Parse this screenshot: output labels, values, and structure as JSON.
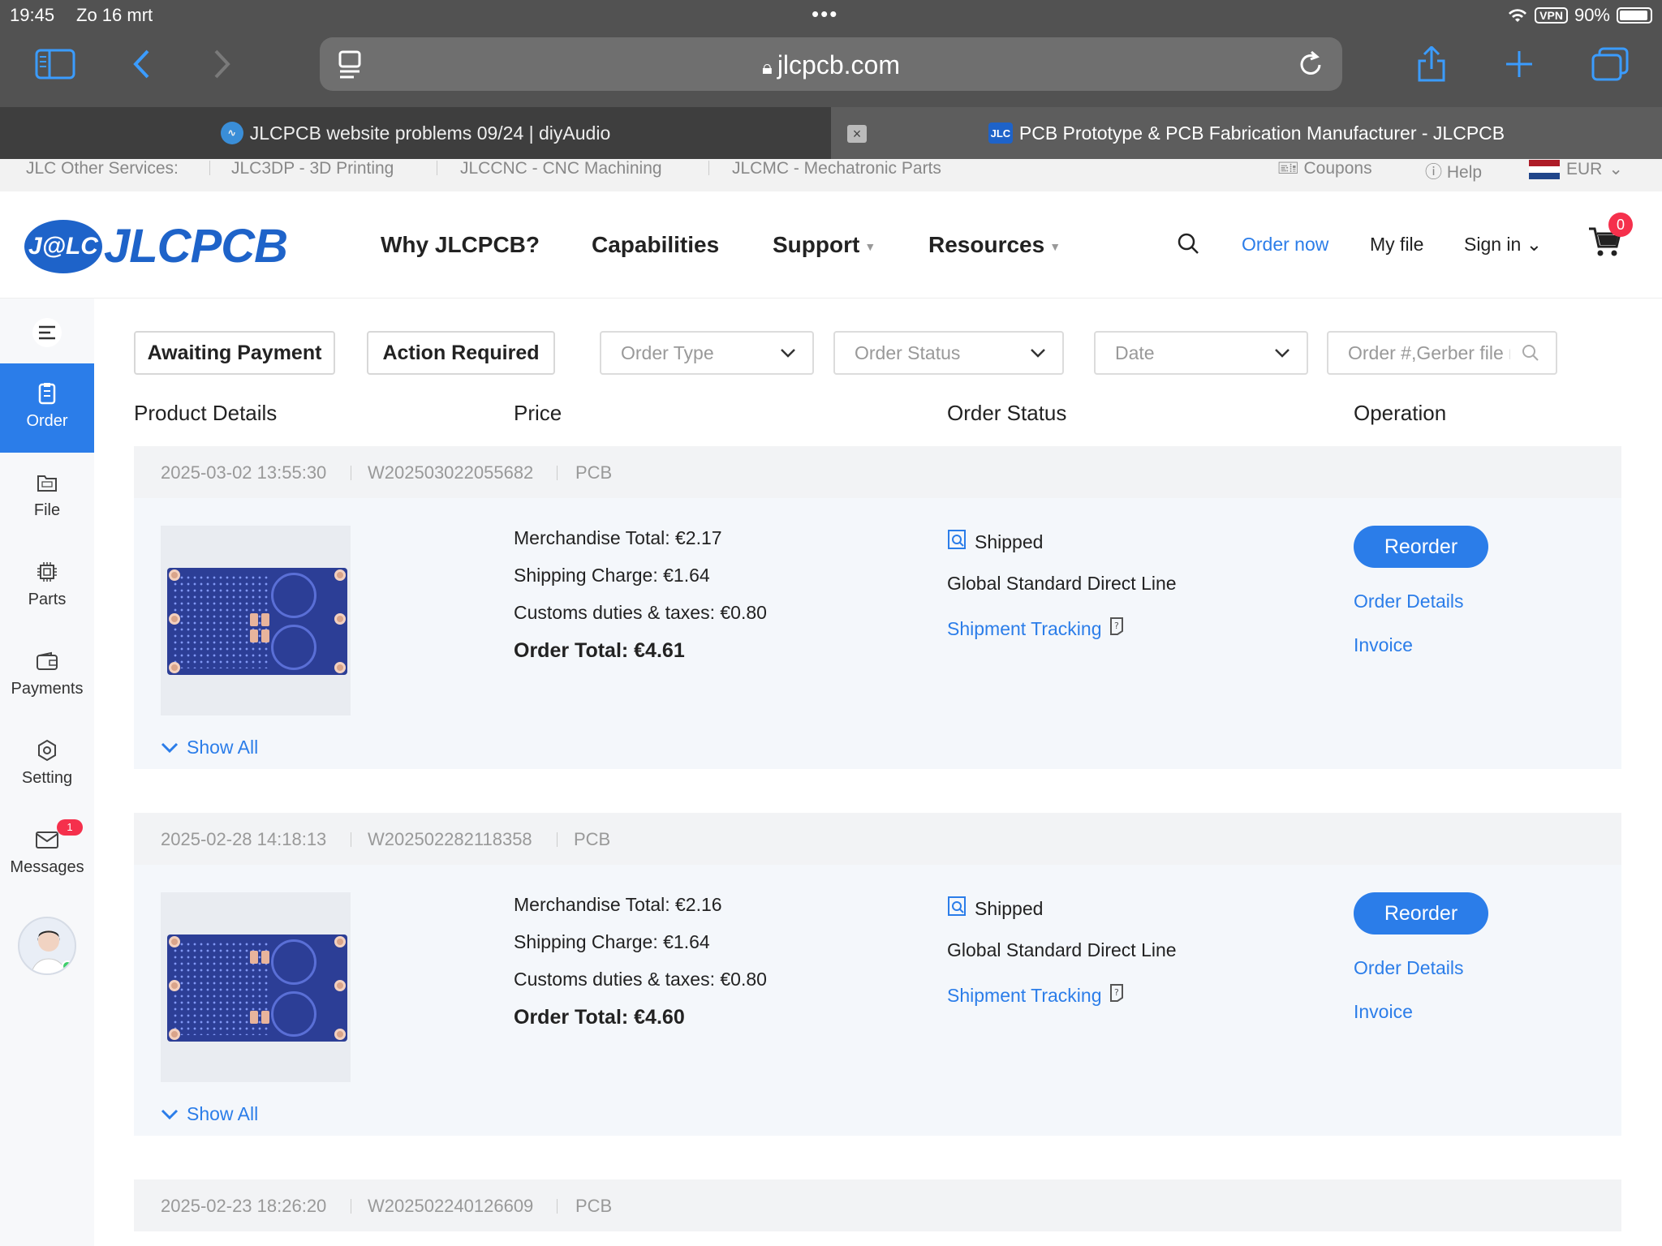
{
  "device": {
    "time": "19:45",
    "date": "Zo 16 mrt",
    "vpn": "VPN",
    "battery": "90%"
  },
  "browser": {
    "url": "jlcpcb.com",
    "tabs": [
      {
        "title": "JLCPCB website problems 09/24 | diyAudio"
      },
      {
        "title": "PCB Prototype & PCB Fabrication Manufacturer - JLCPCB",
        "favicon_text": "JLC"
      }
    ]
  },
  "services_bar": {
    "label": "JLC Other Services:",
    "items": [
      "JLC3DP - 3D Printing",
      "JLCCNC - CNC Machining",
      "JLCMC - Mechatronic Parts"
    ],
    "coupons": "Coupons",
    "help": "Help",
    "currency": "EUR"
  },
  "header": {
    "logo_badge": "J@LC",
    "logo_text": "JLCPCB",
    "nav": [
      "Why JLCPCB?",
      "Capabilities",
      "Support",
      "Resources"
    ],
    "order_now": "Order now",
    "my_file": "My file",
    "sign_in": "Sign in",
    "cart_count": "0"
  },
  "sidebar": {
    "items": [
      {
        "label": "Order",
        "icon": "order-icon",
        "active": true
      },
      {
        "label": "File",
        "icon": "file-icon"
      },
      {
        "label": "Parts",
        "icon": "chip-icon"
      },
      {
        "label": "Payments",
        "icon": "wallet-icon"
      },
      {
        "label": "Setting",
        "icon": "gear-icon"
      },
      {
        "label": "Messages",
        "icon": "mail-icon",
        "badge": "1"
      }
    ]
  },
  "filters": {
    "awaiting_payment": "Awaiting Payment",
    "action_required": "Action Required",
    "order_type": "Order Type",
    "order_status": "Order Status",
    "date": "Date",
    "search_placeholder": "Order #,Gerber file name"
  },
  "columns": {
    "product": "Product Details",
    "price": "Price",
    "status": "Order Status",
    "operation": "Operation"
  },
  "orders": [
    {
      "datetime": "2025-03-02 13:55:30",
      "order_no": "W202503022055682",
      "type": "PCB",
      "merchandise": "Merchandise Total: €2.17",
      "shipping": "Shipping Charge: €1.64",
      "customs": "Customs duties & taxes: €0.80",
      "total": "Order Total: €4.61",
      "status": "Shipped",
      "shipping_method": "Global Standard Direct Line",
      "tracking": "Shipment Tracking",
      "reorder": "Reorder",
      "details": "Order Details",
      "invoice": "Invoice",
      "show_all": "Show All"
    },
    {
      "datetime": "2025-02-28 14:18:13",
      "order_no": "W202502282118358",
      "type": "PCB",
      "merchandise": "Merchandise Total: €2.16",
      "shipping": "Shipping Charge: €1.64",
      "customs": "Customs duties & taxes: €0.80",
      "total": "Order Total: €4.60",
      "status": "Shipped",
      "shipping_method": "Global Standard Direct Line",
      "tracking": "Shipment Tracking",
      "reorder": "Reorder",
      "details": "Order Details",
      "invoice": "Invoice",
      "show_all": "Show All"
    },
    {
      "datetime": "2025-02-23 18:26:20",
      "order_no": "W202502240126609",
      "type": "PCB"
    }
  ],
  "colors": {
    "accent": "#2b7de9",
    "brand": "#1e63c9",
    "badge": "#f5304c"
  }
}
